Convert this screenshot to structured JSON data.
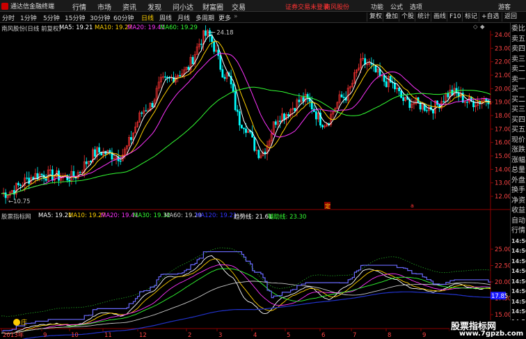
{
  "app": {
    "brand": "通达信金融终端",
    "menu": [
      "行情",
      "市场",
      "资讯",
      "发现",
      "问小达",
      "财富圈",
      "交易"
    ],
    "notice": "证券交易未登录",
    "stock_name": "南风股份",
    "right_menu": [
      "功能",
      "公式",
      "选项",
      "游客"
    ]
  },
  "toolbar": {
    "periods": [
      "分时",
      "1分钟",
      "5分钟",
      "15分钟",
      "30分钟",
      "60分钟",
      "日线",
      "周线",
      "月线",
      "多周期",
      "更多"
    ],
    "active_period": "日线",
    "right_buttons": [
      "复权",
      "叠加",
      "个股",
      "统计",
      "画线",
      "F10",
      "标记",
      "+自选",
      "返回"
    ]
  },
  "main_chart": {
    "title": "南风股份(日线 前复权)",
    "indicators": [
      {
        "label": "MA5: 19.21",
        "color": "#ffffff"
      },
      {
        "label": "MA10: 19.27",
        "color": "#ffd000"
      },
      {
        "label": "MA20: 19.41",
        "color": "#ff33ff"
      },
      {
        "label": "MA60: 19.29",
        "color": "#33ff33"
      }
    ],
    "high_label": "24.18",
    "low_label": "10.75",
    "y_ticks": [
      "24.00",
      "23.00",
      "22.00",
      "21.00",
      "20.00",
      "19.00",
      "18.00",
      "17.00",
      "16.00",
      "15.00",
      "14.00",
      "13.00",
      "12.00"
    ],
    "marker1": "定",
    "marker2": "a"
  },
  "sub_chart": {
    "title": "股票指标网",
    "indicators": [
      {
        "label": "MA5: 19.21",
        "color": "#ffffff"
      },
      {
        "label": "MA10: 19.27",
        "color": "#ffd000"
      },
      {
        "label": "MA20: 19.41",
        "color": "#ff33ff"
      },
      {
        "label": "MA30: 19.32",
        "color": "#33ff33"
      },
      {
        "label": "MA60: 19.29",
        "color": "#cccccc"
      },
      {
        "label": "MA120: 19.21",
        "color": "#3333ff"
      },
      {
        "label": "趋势线: 21.61",
        "color": "#ffffff"
      },
      {
        "label": "辅助线: 23.30",
        "color": "#33ff33"
      }
    ],
    "y_ticks": [
      "25.00",
      "22.50",
      "20.00",
      "17.50",
      "15.00"
    ],
    "current_value": "17.85",
    "bottom_label": "庄"
  },
  "x_axis": {
    "labels": [
      "2013年",
      "9",
      "10",
      "11",
      "12",
      "2",
      "3",
      "4",
      "5",
      "6",
      "7",
      "8",
      "9",
      "10",
      "11"
    ]
  },
  "right_panel": {
    "items": [
      "委比",
      "卖五",
      "卖四",
      "卖三",
      "卖二",
      "卖一",
      "买一",
      "买二",
      "买三",
      "买四",
      "买五",
      "现价",
      "涨跌",
      "涨幅",
      "总量",
      "外盘",
      "换手",
      "净资",
      "收益",
      "自动",
      "行情",
      "14:56",
      "14:56",
      "14:56",
      "14:56",
      "14:56",
      "14:56",
      "14:56",
      "14:56",
      "14:56"
    ]
  },
  "watermark": {
    "line1": "股票指标网",
    "line2": "www.7gpzb.com"
  },
  "colors": {
    "up": "#ff3333",
    "down": "#00ffff",
    "ma5": "#ffffff",
    "ma10": "#ffd000",
    "ma20": "#ff33ff",
    "ma60": "#33ff33",
    "trend_blue": "#6a6aff",
    "ma120_blue": "#2233cc"
  }
}
